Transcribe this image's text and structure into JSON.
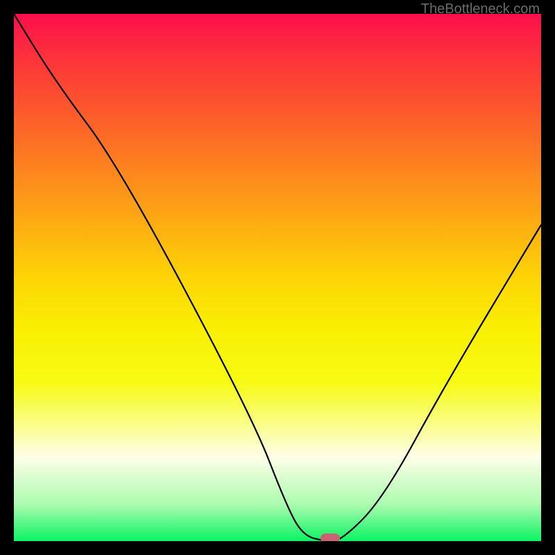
{
  "watermark": "TheBottleneck.com",
  "chart_data": {
    "type": "line",
    "title": "",
    "xlabel": "",
    "ylabel": "",
    "xlim": [
      0,
      100
    ],
    "ylim": [
      0,
      100
    ],
    "x": [
      0,
      8,
      20,
      45,
      52,
      55,
      59,
      62,
      70,
      82,
      100
    ],
    "values": [
      100,
      87,
      71,
      24,
      6,
      1,
      0,
      0,
      8,
      30,
      60
    ],
    "grid": false,
    "legend": false,
    "background": "red-yellow-green vertical gradient",
    "marker": {
      "x": 60,
      "y": 0.5,
      "color": "#cc6375"
    }
  }
}
